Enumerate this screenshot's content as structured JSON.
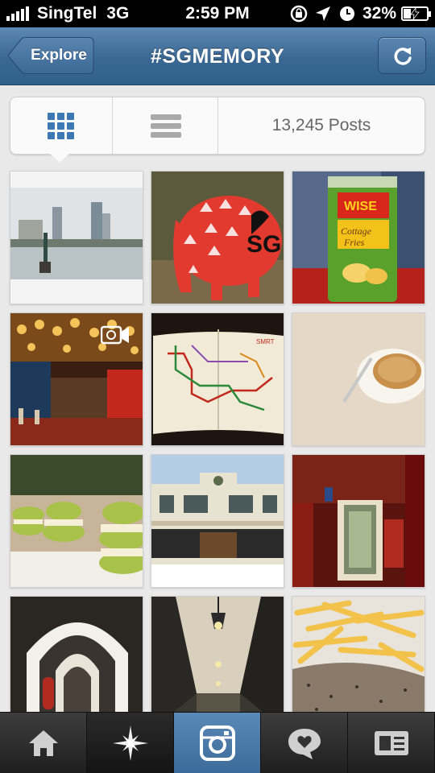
{
  "status_bar": {
    "carrier": "SingTel",
    "network": "3G",
    "time": "2:59 PM",
    "battery_percent": "32%",
    "battery_level": 0.32,
    "icons": [
      "rotation-lock-icon",
      "location-arrow-icon",
      "alarm-clock-icon",
      "battery-charging-icon"
    ]
  },
  "nav": {
    "back_label": "Explore",
    "title": "#SGMEMORY",
    "refresh_icon": "refresh-icon"
  },
  "view_toggle": {
    "grid_icon": "grid-view-icon",
    "list_icon": "list-view-icon",
    "selected": "grid",
    "post_count": "13,245 Posts"
  },
  "photos": [
    {
      "subject": "riverside-skyline",
      "is_video": false
    },
    {
      "subject": "i-love-sg-elephant",
      "is_video": false
    },
    {
      "subject": "cottage-fries-snack-can",
      "is_video": false
    },
    {
      "subject": "lantern-hall-interior",
      "is_video": true
    },
    {
      "subject": "mrt-route-map-book",
      "is_video": false
    },
    {
      "subject": "cookie-on-plate",
      "is_video": false
    },
    {
      "subject": "green-macarons",
      "is_video": false
    },
    {
      "subject": "shophouse-facade",
      "is_video": false
    },
    {
      "subject": "red-lit-doorway",
      "is_video": false
    },
    {
      "subject": "arched-corridor",
      "is_video": false
    },
    {
      "subject": "ceiling-lamps-corridor",
      "is_video": false
    },
    {
      "subject": "fries-with-pepper-sauce",
      "is_video": false
    }
  ],
  "tab_bar": {
    "tabs": [
      "home-icon",
      "explore-star-icon",
      "camera-icon",
      "news-heart-icon",
      "profile-card-icon"
    ],
    "selected": "camera-icon"
  },
  "colors": {
    "nav_blue": "#3a6893",
    "accent_blue": "#3c78b4",
    "tab_dark": "#1f1f1f"
  }
}
